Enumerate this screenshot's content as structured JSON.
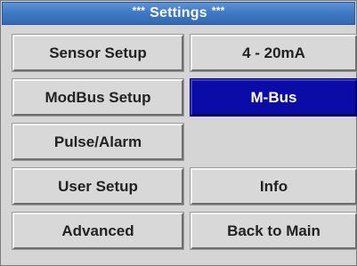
{
  "header": {
    "title": "Settings",
    "stars_left": "***",
    "stars_right": "***"
  },
  "menu": {
    "sensor_setup": "Sensor Setup",
    "modbus_setup": "ModBus Setup",
    "pulse_alarm": "Pulse/Alarm",
    "user_setup": "User Setup",
    "advanced": "Advanced",
    "current_4_20ma": "4 - 20mA",
    "m_bus": "M-Bus",
    "info": "Info",
    "back_to_main": "Back to Main"
  },
  "state": {
    "selected_item": "M-Bus"
  },
  "colors": {
    "title_bar": "#3f78c2",
    "selected_button": "#0b0ba8",
    "button_face": "#d8d8d8",
    "screen_background": "#d5d5d5"
  }
}
